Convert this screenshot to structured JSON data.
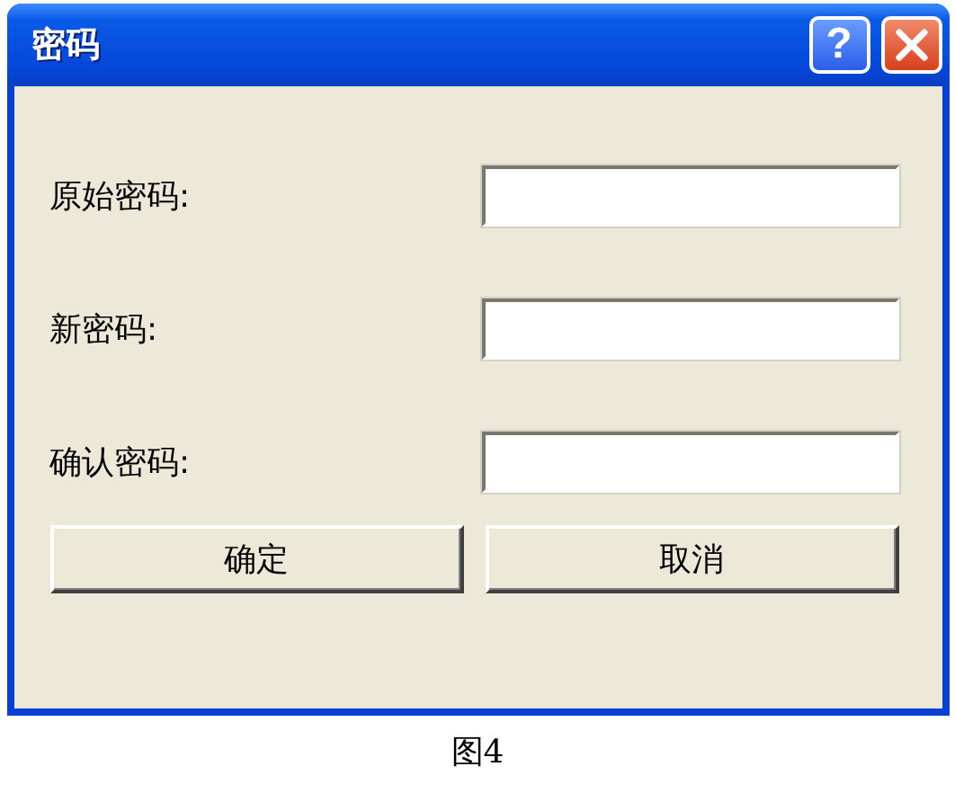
{
  "window": {
    "title": "密码"
  },
  "title_buttons": [
    {
      "kind": "help",
      "label": "?"
    },
    {
      "kind": "close"
    }
  ],
  "fields": [
    {
      "label": "原始密码:"
    },
    {
      "label": "新密码:"
    },
    {
      "label": "确认密码:"
    }
  ],
  "buttons": [
    "确定",
    "取消"
  ],
  "caption": "图4"
}
